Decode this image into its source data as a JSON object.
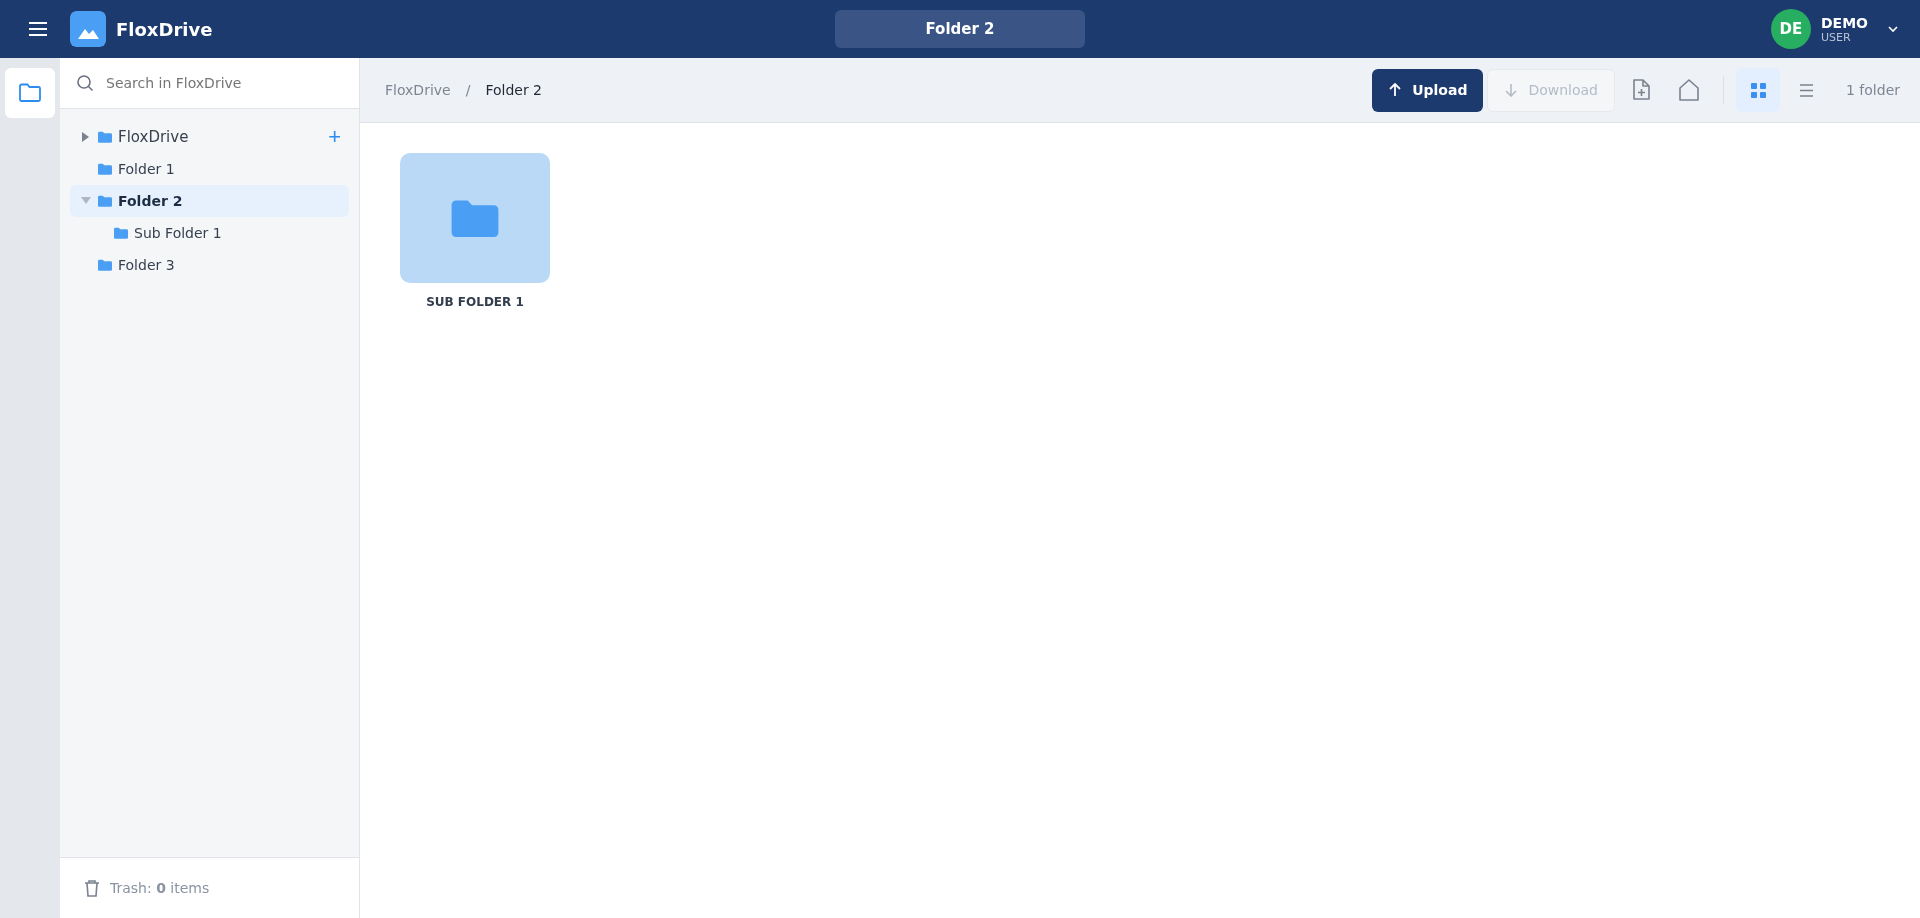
{
  "header": {
    "brand": "FloxDrive",
    "current_folder": "Folder 2",
    "user": {
      "initials": "DE",
      "name": "DEMO",
      "role": "USER"
    }
  },
  "sidebar": {
    "search": {
      "placeholder": "Search in FloxDrive"
    },
    "tree": {
      "label": "FloxDrive",
      "expanded": false,
      "add": "+",
      "children": [
        {
          "label": "Folder 1",
          "selected": false
        },
        {
          "label": "Folder 2",
          "selected": true,
          "expanded": true,
          "children": [
            {
              "label": "Sub Folder 1",
              "selected": false
            }
          ]
        },
        {
          "label": "Folder 3",
          "selected": false
        }
      ]
    },
    "trash": "Trash: **0** items"
  },
  "breadcrumb": [
    {
      "label": "FloxDrive",
      "current": false
    },
    {
      "label": "Folder 2",
      "current": true
    }
  ],
  "breadcrumb_separator": "/",
  "toolbar": {
    "upload": "Upload",
    "download": {
      "label": "Download",
      "disabled": true
    },
    "view": [
      {
        "kind": "grid",
        "selected": true
      },
      {
        "kind": "list",
        "selected": false
      }
    ],
    "count": "1 folder"
  },
  "items": [
    {
      "label": "SUB FOLDER 1"
    }
  ]
}
